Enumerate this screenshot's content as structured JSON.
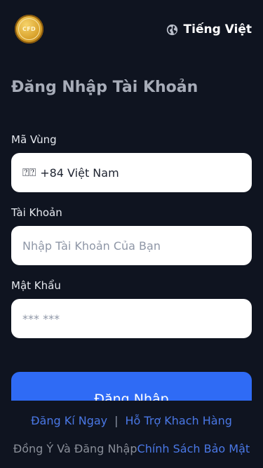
{
  "header": {
    "logo_text": "CFD",
    "language": "Tiếng Việt"
  },
  "title": "Đăng Nhập Tài Khoản",
  "region": {
    "label": "Mã Vùng",
    "flag": "⍰⍰",
    "value": "+84 Việt Nam"
  },
  "account": {
    "label": "Tài Khoản",
    "placeholder": "Nhập Tài Khoản Của Bạn"
  },
  "password": {
    "label": "Mật Khẩu",
    "placeholder": "*** ***"
  },
  "login_button": "Đăng Nhập",
  "footer": {
    "register": "Đăng Kí Ngay",
    "separator": "|",
    "support": "Hỗ Trợ Khach Hàng",
    "policy_prefix": "Đồng Ý Và Đăng Nhập",
    "policy_link": "Chính Sách Bảo Mật"
  },
  "colors": {
    "background": "#0f1420",
    "primary": "#2f6bf5",
    "link": "#4a78e6"
  }
}
